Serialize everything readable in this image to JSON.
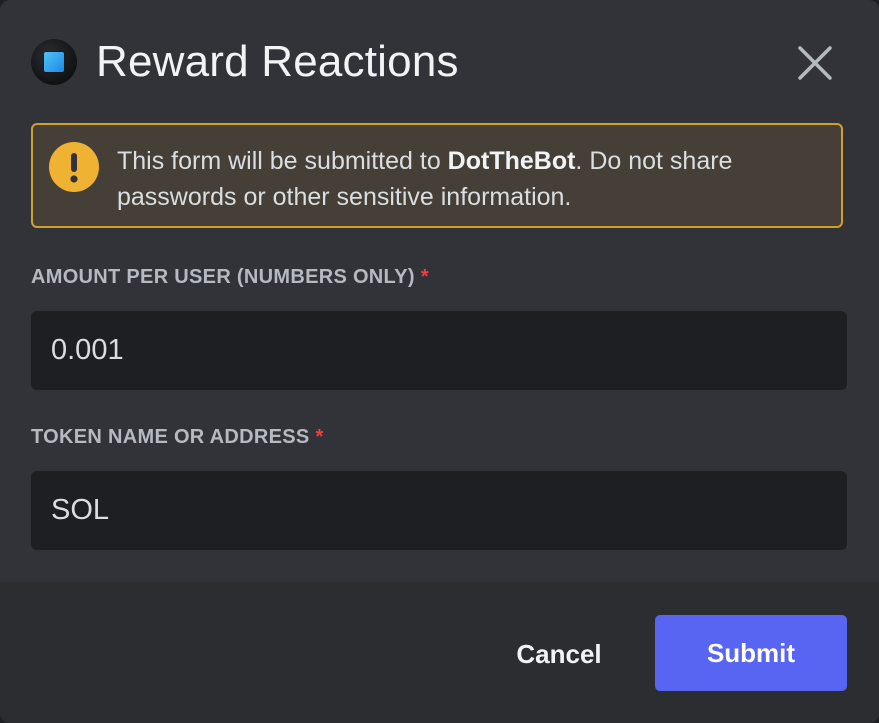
{
  "modal": {
    "title": "Reward Reactions",
    "app_icon": "app-square-icon",
    "close_icon": "close-icon"
  },
  "warning": {
    "icon": "exclamation-icon",
    "prefix": "This form will be submitted to ",
    "bot_name": "DotTheBot",
    "suffix": ". Do not share passwords or other sensitive information."
  },
  "fields": [
    {
      "label": "AMOUNT PER USER (NUMBERS ONLY)",
      "required_mark": "*",
      "value": "0.001"
    },
    {
      "label": "TOKEN NAME OR ADDRESS",
      "required_mark": "*",
      "value": "SOL"
    }
  ],
  "footer": {
    "cancel_label": "Cancel",
    "submit_label": "Submit"
  },
  "colors": {
    "background": "#313338",
    "footer": "#2b2d31",
    "input": "#1e1f22",
    "warning_border": "#d0a02a",
    "warning_icon": "#f0b232",
    "required": "#f23f43",
    "submit": "#5865f2"
  }
}
